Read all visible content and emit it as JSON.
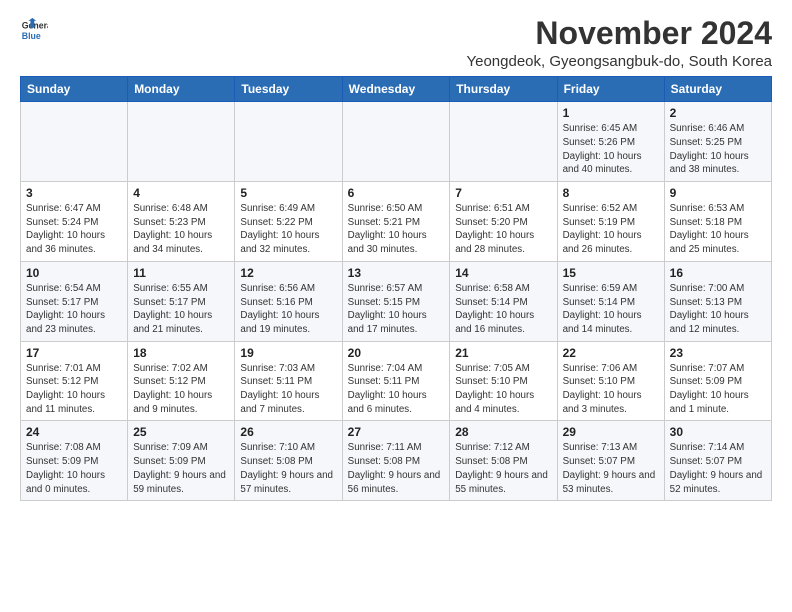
{
  "logo": {
    "line1": "General",
    "line2": "Blue"
  },
  "title": "November 2024",
  "subtitle": "Yeongdeok, Gyeongsangbuk-do, South Korea",
  "weekdays": [
    "Sunday",
    "Monday",
    "Tuesday",
    "Wednesday",
    "Thursday",
    "Friday",
    "Saturday"
  ],
  "weeks": [
    [
      {
        "day": "",
        "info": ""
      },
      {
        "day": "",
        "info": ""
      },
      {
        "day": "",
        "info": ""
      },
      {
        "day": "",
        "info": ""
      },
      {
        "day": "",
        "info": ""
      },
      {
        "day": "1",
        "info": "Sunrise: 6:45 AM\nSunset: 5:26 PM\nDaylight: 10 hours and 40 minutes."
      },
      {
        "day": "2",
        "info": "Sunrise: 6:46 AM\nSunset: 5:25 PM\nDaylight: 10 hours and 38 minutes."
      }
    ],
    [
      {
        "day": "3",
        "info": "Sunrise: 6:47 AM\nSunset: 5:24 PM\nDaylight: 10 hours and 36 minutes."
      },
      {
        "day": "4",
        "info": "Sunrise: 6:48 AM\nSunset: 5:23 PM\nDaylight: 10 hours and 34 minutes."
      },
      {
        "day": "5",
        "info": "Sunrise: 6:49 AM\nSunset: 5:22 PM\nDaylight: 10 hours and 32 minutes."
      },
      {
        "day": "6",
        "info": "Sunrise: 6:50 AM\nSunset: 5:21 PM\nDaylight: 10 hours and 30 minutes."
      },
      {
        "day": "7",
        "info": "Sunrise: 6:51 AM\nSunset: 5:20 PM\nDaylight: 10 hours and 28 minutes."
      },
      {
        "day": "8",
        "info": "Sunrise: 6:52 AM\nSunset: 5:19 PM\nDaylight: 10 hours and 26 minutes."
      },
      {
        "day": "9",
        "info": "Sunrise: 6:53 AM\nSunset: 5:18 PM\nDaylight: 10 hours and 25 minutes."
      }
    ],
    [
      {
        "day": "10",
        "info": "Sunrise: 6:54 AM\nSunset: 5:17 PM\nDaylight: 10 hours and 23 minutes."
      },
      {
        "day": "11",
        "info": "Sunrise: 6:55 AM\nSunset: 5:17 PM\nDaylight: 10 hours and 21 minutes."
      },
      {
        "day": "12",
        "info": "Sunrise: 6:56 AM\nSunset: 5:16 PM\nDaylight: 10 hours and 19 minutes."
      },
      {
        "day": "13",
        "info": "Sunrise: 6:57 AM\nSunset: 5:15 PM\nDaylight: 10 hours and 17 minutes."
      },
      {
        "day": "14",
        "info": "Sunrise: 6:58 AM\nSunset: 5:14 PM\nDaylight: 10 hours and 16 minutes."
      },
      {
        "day": "15",
        "info": "Sunrise: 6:59 AM\nSunset: 5:14 PM\nDaylight: 10 hours and 14 minutes."
      },
      {
        "day": "16",
        "info": "Sunrise: 7:00 AM\nSunset: 5:13 PM\nDaylight: 10 hours and 12 minutes."
      }
    ],
    [
      {
        "day": "17",
        "info": "Sunrise: 7:01 AM\nSunset: 5:12 PM\nDaylight: 10 hours and 11 minutes."
      },
      {
        "day": "18",
        "info": "Sunrise: 7:02 AM\nSunset: 5:12 PM\nDaylight: 10 hours and 9 minutes."
      },
      {
        "day": "19",
        "info": "Sunrise: 7:03 AM\nSunset: 5:11 PM\nDaylight: 10 hours and 7 minutes."
      },
      {
        "day": "20",
        "info": "Sunrise: 7:04 AM\nSunset: 5:11 PM\nDaylight: 10 hours and 6 minutes."
      },
      {
        "day": "21",
        "info": "Sunrise: 7:05 AM\nSunset: 5:10 PM\nDaylight: 10 hours and 4 minutes."
      },
      {
        "day": "22",
        "info": "Sunrise: 7:06 AM\nSunset: 5:10 PM\nDaylight: 10 hours and 3 minutes."
      },
      {
        "day": "23",
        "info": "Sunrise: 7:07 AM\nSunset: 5:09 PM\nDaylight: 10 hours and 1 minute."
      }
    ],
    [
      {
        "day": "24",
        "info": "Sunrise: 7:08 AM\nSunset: 5:09 PM\nDaylight: 10 hours and 0 minutes."
      },
      {
        "day": "25",
        "info": "Sunrise: 7:09 AM\nSunset: 5:09 PM\nDaylight: 9 hours and 59 minutes."
      },
      {
        "day": "26",
        "info": "Sunrise: 7:10 AM\nSunset: 5:08 PM\nDaylight: 9 hours and 57 minutes."
      },
      {
        "day": "27",
        "info": "Sunrise: 7:11 AM\nSunset: 5:08 PM\nDaylight: 9 hours and 56 minutes."
      },
      {
        "day": "28",
        "info": "Sunrise: 7:12 AM\nSunset: 5:08 PM\nDaylight: 9 hours and 55 minutes."
      },
      {
        "day": "29",
        "info": "Sunrise: 7:13 AM\nSunset: 5:07 PM\nDaylight: 9 hours and 53 minutes."
      },
      {
        "day": "30",
        "info": "Sunrise: 7:14 AM\nSunset: 5:07 PM\nDaylight: 9 hours and 52 minutes."
      }
    ]
  ]
}
